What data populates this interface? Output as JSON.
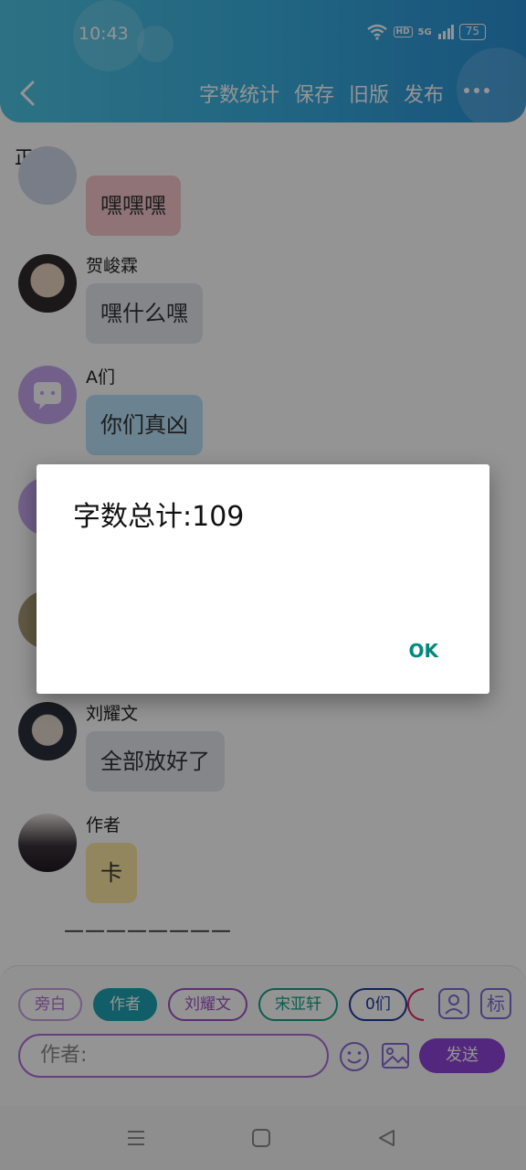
{
  "status_bar": {
    "time": "10:43",
    "hd": "HD",
    "signal": "5G",
    "battery": "75"
  },
  "toolbar": {
    "items": [
      "字数统计",
      "保存",
      "旧版",
      "发布"
    ]
  },
  "section_label": "正文3",
  "messages": [
    {
      "speaker": "",
      "text": "嘿嘿嘿"
    },
    {
      "speaker": "贺峻霖",
      "text": "嘿什么嘿"
    },
    {
      "speaker": "A们",
      "text": "你们真凶"
    },
    {
      "speaker": "刘耀文",
      "text": "全部放好了"
    },
    {
      "speaker": "作者",
      "text": "卡"
    }
  ],
  "separator": "————————",
  "chips": [
    "旁白",
    "作者",
    "刘耀文",
    "宋亚轩",
    "0们"
  ],
  "tag_icon_label": "标",
  "input": {
    "value": "作者:"
  },
  "send_label": "发送",
  "dialog": {
    "title": "字数总计:109",
    "ok_label": "OK"
  },
  "colors": {
    "header": "#3ab0e0",
    "chip_author": "#1fa3b3",
    "send": "#8e44d8",
    "ok": "#00897b"
  }
}
